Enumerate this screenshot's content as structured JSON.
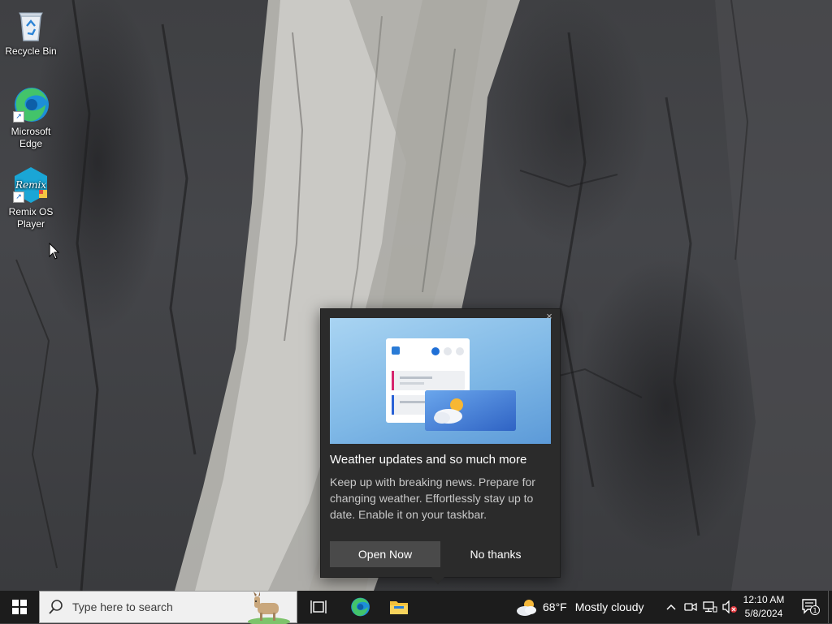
{
  "desktop": {
    "icons": [
      {
        "label": "Recycle Bin",
        "icon": "recycle-bin-icon"
      },
      {
        "label": "Microsoft Edge",
        "icon": "edge-icon"
      },
      {
        "label": "Remix OS Player",
        "icon": "remix-os-icon"
      }
    ]
  },
  "popup": {
    "title": "Weather updates and so much more",
    "body": "Keep up with breaking news. Prepare for changing weather. Effortlessly stay up to date. Enable it on your taskbar.",
    "primary_button": "Open Now",
    "secondary_button": "No thanks",
    "close_glyph": "×"
  },
  "taskbar": {
    "search_placeholder": "Type here to search",
    "weather": {
      "temperature": "68°F",
      "condition": "Mostly cloudy"
    },
    "clock": {
      "time": "12:10 AM",
      "date": "5/8/2024"
    },
    "notification_count": "1"
  },
  "colors": {
    "taskbar": "#1c1c1c",
    "popup_bg": "#2b2b2b",
    "popup_button": "#4a4a4a",
    "accent_blue": "#0078d4"
  }
}
